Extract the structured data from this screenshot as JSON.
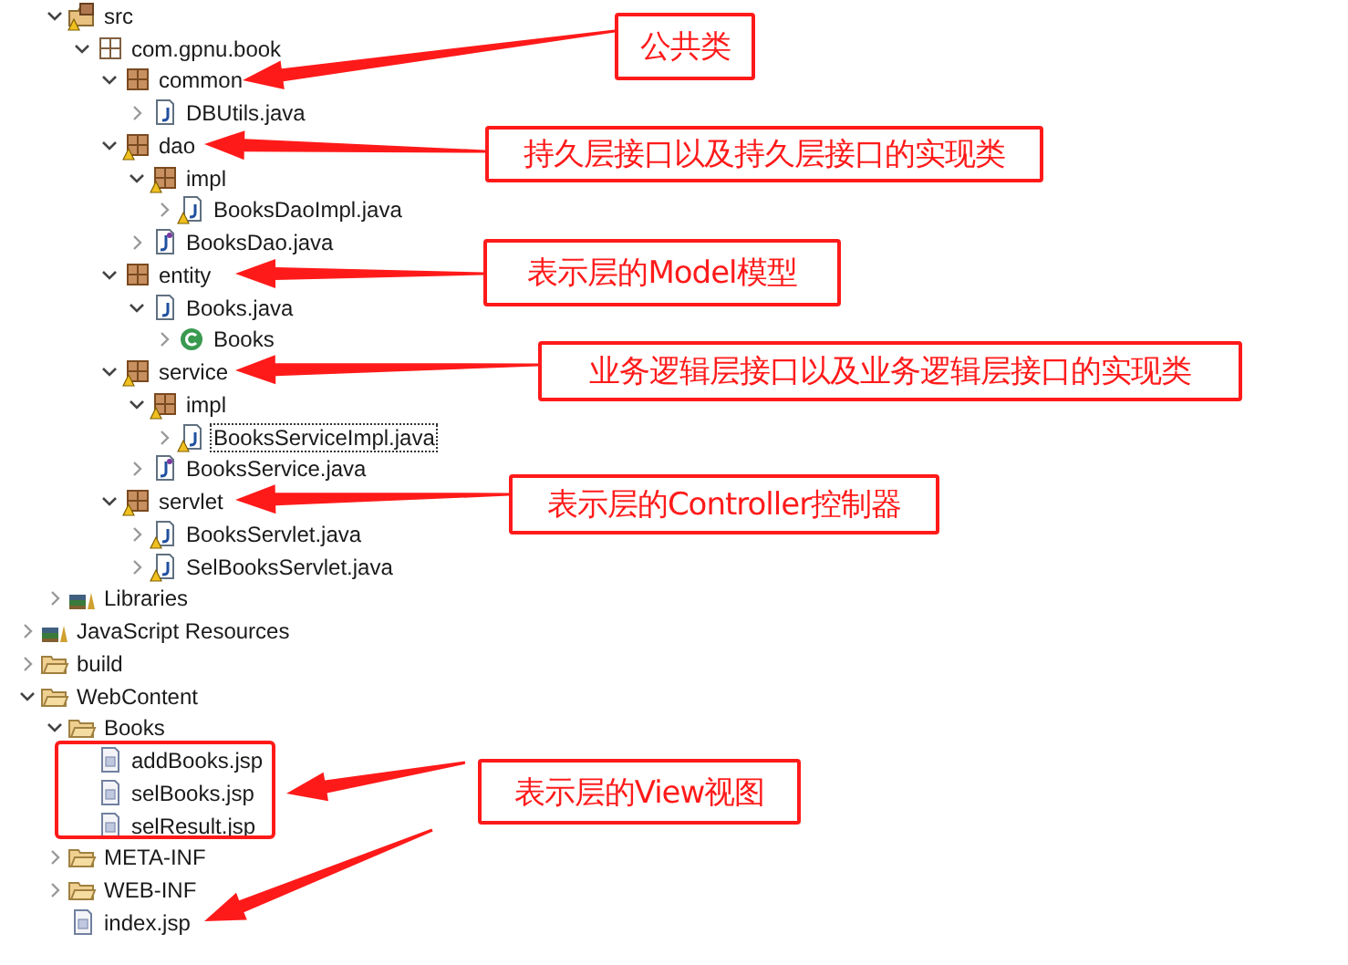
{
  "tree": {
    "cut_off_parent_children": [
      {
        "label": "src",
        "kind": "source-folder",
        "expanded": true,
        "warning": true,
        "focused": false,
        "children": [
          {
            "label": "com.gpnu.book",
            "kind": "empty-package",
            "expanded": true,
            "warning": false,
            "focused": false,
            "children": [
              {
                "label": "common",
                "kind": "package",
                "expanded": true,
                "warning": false,
                "focused": false,
                "children": [
                  {
                    "label": "DBUtils.java",
                    "kind": "java-file",
                    "expanded": false,
                    "warning": false,
                    "focused": false
                  }
                ]
              },
              {
                "label": "dao",
                "kind": "package",
                "expanded": true,
                "warning": true,
                "focused": false,
                "children": [
                  {
                    "label": "impl",
                    "kind": "package",
                    "expanded": true,
                    "warning": true,
                    "focused": false,
                    "children": [
                      {
                        "label": "BooksDaoImpl.java",
                        "kind": "java-file",
                        "expanded": false,
                        "warning": true,
                        "focused": false
                      }
                    ]
                  },
                  {
                    "label": "BooksDao.java",
                    "kind": "interface-file",
                    "expanded": false,
                    "warning": false,
                    "focused": false
                  }
                ]
              },
              {
                "label": "entity",
                "kind": "package",
                "expanded": true,
                "warning": false,
                "focused": false,
                "children": [
                  {
                    "label": "Books.java",
                    "kind": "java-file",
                    "expanded": true,
                    "warning": false,
                    "focused": false,
                    "children": [
                      {
                        "label": "Books",
                        "kind": "class",
                        "expanded": false,
                        "warning": false,
                        "focused": false
                      }
                    ]
                  }
                ]
              },
              {
                "label": "service",
                "kind": "package",
                "expanded": true,
                "warning": true,
                "focused": false,
                "children": [
                  {
                    "label": "impl",
                    "kind": "package",
                    "expanded": true,
                    "warning": true,
                    "focused": false,
                    "children": [
                      {
                        "label": "BooksServiceImpl.java",
                        "kind": "java-file",
                        "expanded": false,
                        "warning": true,
                        "focused": true
                      }
                    ]
                  },
                  {
                    "label": "BooksService.java",
                    "kind": "interface-file",
                    "expanded": false,
                    "warning": false,
                    "focused": false
                  }
                ]
              },
              {
                "label": "servlet",
                "kind": "package",
                "expanded": true,
                "warning": true,
                "focused": false,
                "children": [
                  {
                    "label": "BooksServlet.java",
                    "kind": "java-file",
                    "expanded": false,
                    "warning": true,
                    "focused": false
                  },
                  {
                    "label": "SelBooksServlet.java",
                    "kind": "java-file",
                    "expanded": false,
                    "warning": true,
                    "focused": false
                  }
                ]
              }
            ]
          }
        ]
      },
      {
        "label": "Libraries",
        "kind": "library",
        "expanded": false,
        "warning": false,
        "focused": false
      }
    ],
    "items": [
      {
        "label": "JavaScript Resources",
        "kind": "library",
        "expanded": false,
        "warning": false,
        "focused": false
      },
      {
        "label": "build",
        "kind": "folder",
        "expanded": false,
        "warning": false,
        "focused": false
      },
      {
        "label": "WebContent",
        "kind": "folder",
        "expanded": true,
        "warning": false,
        "focused": false,
        "children": [
          {
            "label": "Books",
            "kind": "folder",
            "expanded": true,
            "warning": false,
            "focused": false,
            "children": [
              {
                "label": "addBooks.jsp",
                "kind": "jsp-file",
                "warning": false,
                "focused": false
              },
              {
                "label": "selBooks.jsp",
                "kind": "jsp-file",
                "warning": false,
                "focused": false
              },
              {
                "label": "selResult.jsp",
                "kind": "jsp-file",
                "warning": false,
                "focused": false
              }
            ]
          },
          {
            "label": "META-INF",
            "kind": "folder",
            "expanded": false,
            "warning": false,
            "focused": false
          },
          {
            "label": "WEB-INF",
            "kind": "folder",
            "expanded": false,
            "warning": false,
            "focused": false
          },
          {
            "label": "index.jsp",
            "kind": "jsp-file",
            "warning": false,
            "focused": false
          }
        ]
      }
    ]
  },
  "annotations": [
    {
      "text": "公共类"
    },
    {
      "text": "持久层接口以及持久层接口的实现类"
    },
    {
      "text": "表示层的Model模型"
    },
    {
      "text": "业务逻辑层接口以及业务逻辑层接口的实现类"
    },
    {
      "text": "表示层的Controller控制器"
    },
    {
      "text": "表示层的View视图"
    }
  ]
}
